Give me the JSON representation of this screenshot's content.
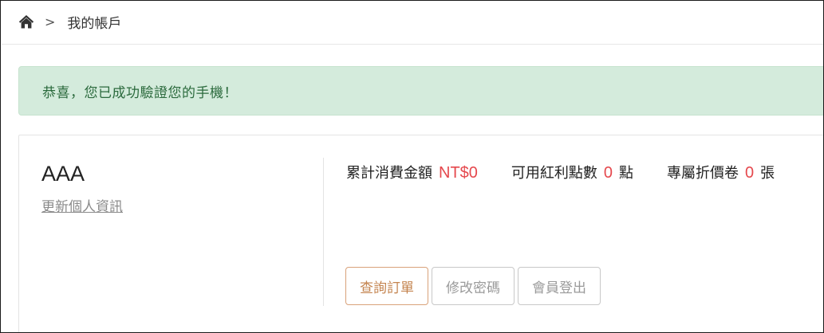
{
  "breadcrumb": {
    "home_icon": "home-icon",
    "separator": ">",
    "current": "我的帳戶"
  },
  "alert": {
    "message": "恭喜，您已成功驗證您的手機！",
    "color": "#2b6a3d",
    "background": "#d4ebdc"
  },
  "account": {
    "name": "AAA",
    "update_link": "更新個人資訊",
    "stats": {
      "spend_label": "累計消費金額",
      "spend_value": "NT$0",
      "points_label": "可用紅利點數",
      "points_value": "0",
      "points_unit": "點",
      "coupons_label": "專屬折價卷",
      "coupons_value": "0",
      "coupons_unit": "張"
    },
    "accent_color": "#e5484d"
  },
  "buttons": {
    "orders": "查詢訂單",
    "change_password": "修改密碼",
    "logout": "會員登出"
  }
}
